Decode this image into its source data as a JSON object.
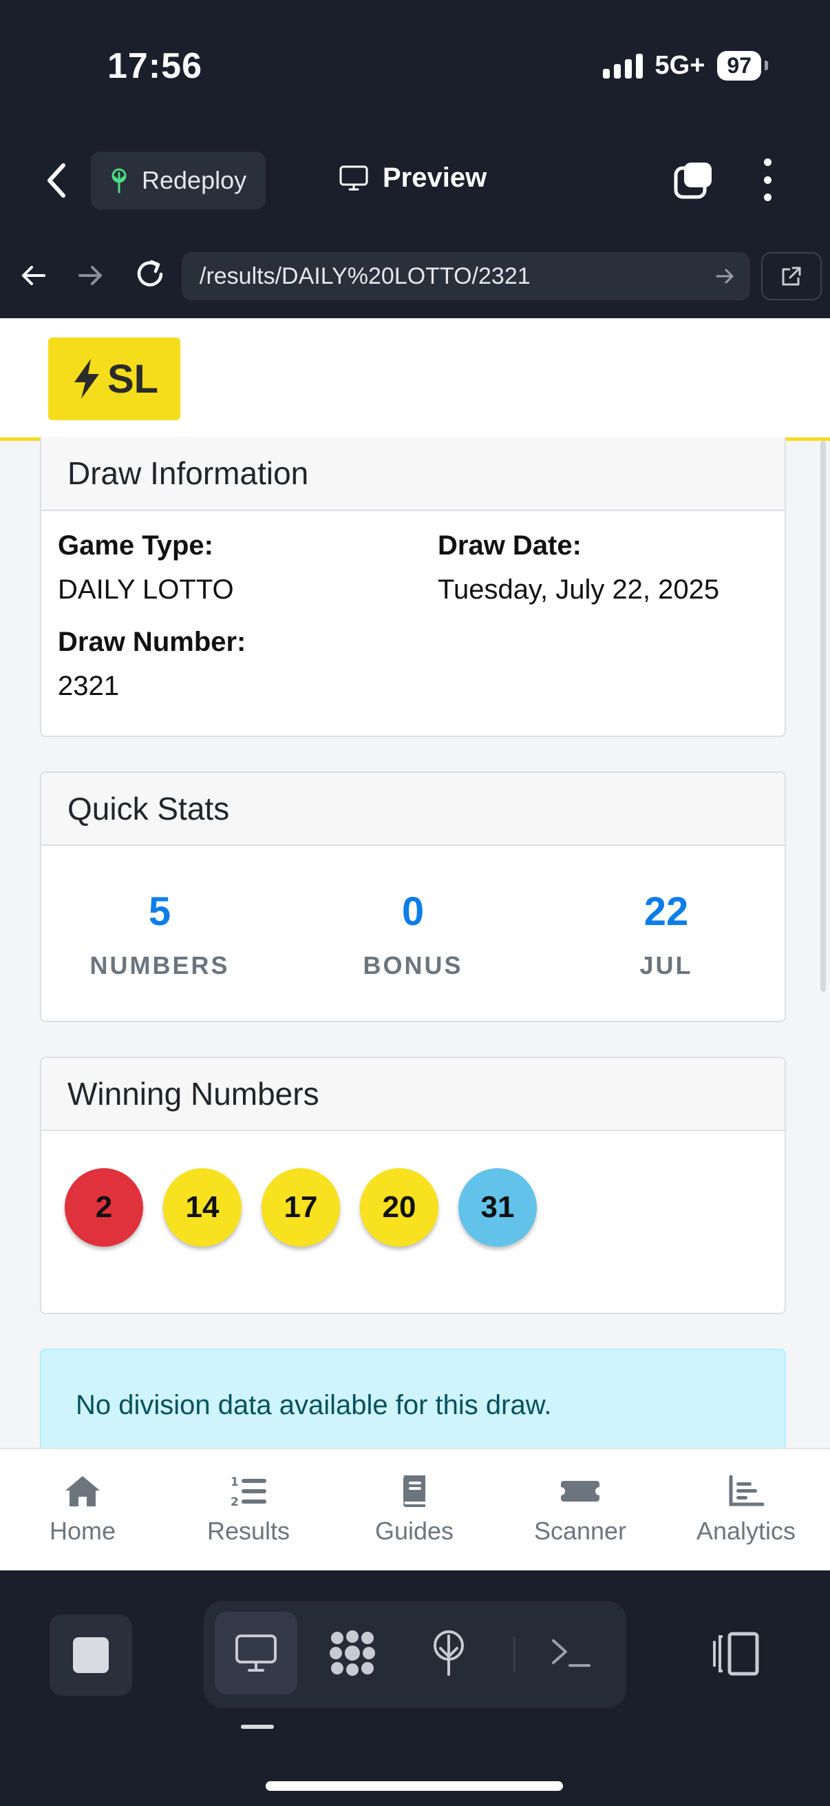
{
  "status_bar": {
    "time": "17:56",
    "network": "5G+",
    "battery": "97"
  },
  "browser": {
    "redeploy_label": "Redeploy",
    "preview_label": "Preview",
    "url": "/results/DAILY%20LOTTO/2321"
  },
  "app": {
    "logo_text": "SL"
  },
  "draw_info": {
    "title": "Draw Information",
    "game_type_label": "Game Type:",
    "game_type": "DAILY LOTTO",
    "draw_date_label": "Draw Date:",
    "draw_date": "Tuesday, July 22, 2025",
    "draw_number_label": "Draw Number:",
    "draw_number": "2321"
  },
  "quick_stats": {
    "title": "Quick Stats",
    "items": [
      {
        "value": "5",
        "label": "NUMBERS"
      },
      {
        "value": "0",
        "label": "BONUS"
      },
      {
        "value": "22",
        "label": "JUL"
      }
    ]
  },
  "winning_numbers": {
    "title": "Winning Numbers",
    "balls": [
      {
        "number": "2",
        "color": "#e0323c"
      },
      {
        "number": "14",
        "color": "#f8e11f"
      },
      {
        "number": "17",
        "color": "#f8e11f"
      },
      {
        "number": "20",
        "color": "#f8e11f"
      },
      {
        "number": "31",
        "color": "#62c2ea"
      }
    ]
  },
  "alert": {
    "text": "No division data available for this draw."
  },
  "bottom_nav": {
    "items": [
      {
        "label": "Home",
        "icon": "home-icon"
      },
      {
        "label": "Results",
        "icon": "numbered-list-icon"
      },
      {
        "label": "Guides",
        "icon": "book-icon"
      },
      {
        "label": "Scanner",
        "icon": "ticket-icon"
      },
      {
        "label": "Analytics",
        "icon": "bar-chart-icon"
      }
    ]
  },
  "colors": {
    "brand_yellow": "#f5dd1c",
    "stat_blue": "#0d7de8",
    "chrome_dark": "#1b1f2b"
  }
}
